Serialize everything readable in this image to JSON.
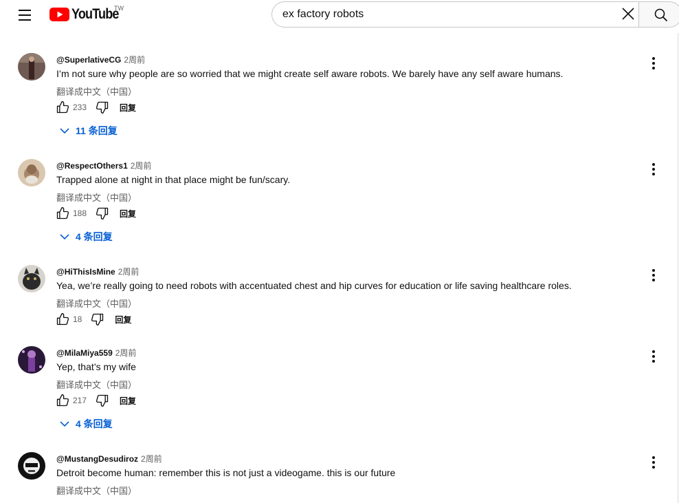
{
  "header": {
    "logo_text": "YouTube",
    "country_code": "TW",
    "search_value": "ex factory robots",
    "colors": {
      "brand_red": "#ff0000",
      "link_blue": "#065fd4"
    }
  },
  "comments": [
    {
      "author": "@SuperlativeCG",
      "time": "2周前",
      "text": "I’m not sure why people are so worried that we might create self aware robots. We barely have any self aware humans.",
      "translate": "翻译成中文（中国）",
      "likes": "233",
      "reply": "回复",
      "replies": "11 条回复"
    },
    {
      "author": "@RespectOthers1",
      "time": "2周前",
      "text": "Trapped alone at night in that place might be fun/scary.",
      "translate": "翻译成中文（中国）",
      "likes": "188",
      "reply": "回复",
      "replies": "4 条回复"
    },
    {
      "author": "@HiThisIsMine",
      "time": "2周前",
      "text": "Yea, we’re really going to need robots with accentuated chest and hip curves for education or life saving healthcare roles.",
      "translate": "翻译成中文（中国）",
      "likes": "18",
      "reply": "回复"
    },
    {
      "author": "@MilaMiya559",
      "time": "2周前",
      "text": "Yep, that’s my wife",
      "translate": "翻译成中文（中国）",
      "likes": "217",
      "reply": "回复",
      "replies": "4 条回复"
    },
    {
      "author": "@MustangDesudiroz",
      "time": "2周前",
      "text": "Detroit become human: remember this is not just a videogame. this is our future",
      "translate": "翻译成中文（中国）"
    }
  ],
  "icons": [
    "menu-icon",
    "youtube-logo-icon",
    "clear-icon",
    "search-icon",
    "thumbs-up-icon",
    "thumbs-down-icon",
    "chevron-down-icon",
    "more-vert-icon"
  ]
}
